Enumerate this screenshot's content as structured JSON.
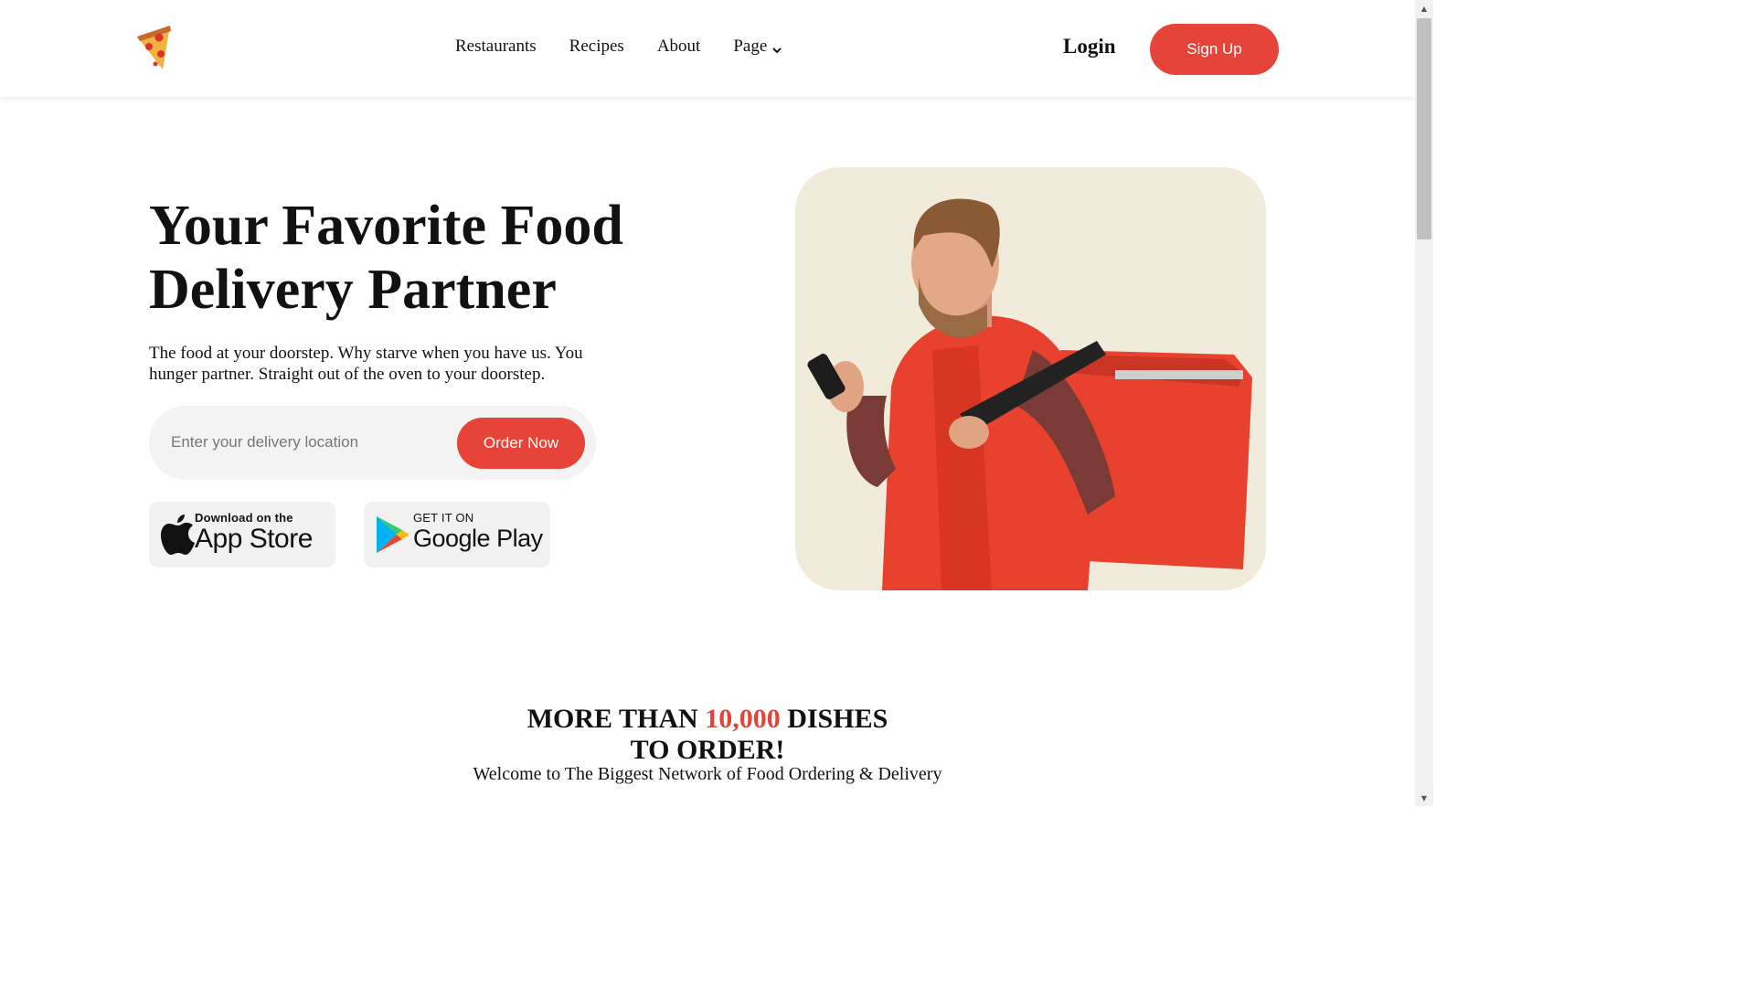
{
  "header": {
    "nav": [
      "Restaurants",
      "Recipes",
      "About",
      "Page"
    ],
    "login_label": "Login",
    "signup_label": "Sign Up"
  },
  "hero": {
    "title_line1": "Your Favorite Food",
    "title_line2": "Delivery Partner",
    "subtitle": "The food at your doorstep. Why starve when you have us. You hunger partner. Straight out of the oven to your doorstep.",
    "search": {
      "placeholder": "Enter your delivery location",
      "value": ""
    },
    "order_label": "Order Now",
    "app_store": {
      "small": "Download on the",
      "big": "App Store"
    },
    "google_play": {
      "small": "GET IT ON",
      "big": "Google Play"
    }
  },
  "dishes": {
    "line1_pre": "MORE THAN ",
    "line1_accent": "10,000",
    "line1_post": " DISHES",
    "line2": "TO ORDER!",
    "subtitle": "Welcome to The Biggest Network of Food Ordering & Delivery"
  },
  "colors": {
    "accent": "#e64339",
    "hero_bg": "#f1ebdc"
  },
  "icons": {
    "logo": "pizza-slice-icon",
    "dropdown": "chevron-down-icon",
    "apple": "apple-logo-icon",
    "google": "google-play-logo-icon"
  }
}
